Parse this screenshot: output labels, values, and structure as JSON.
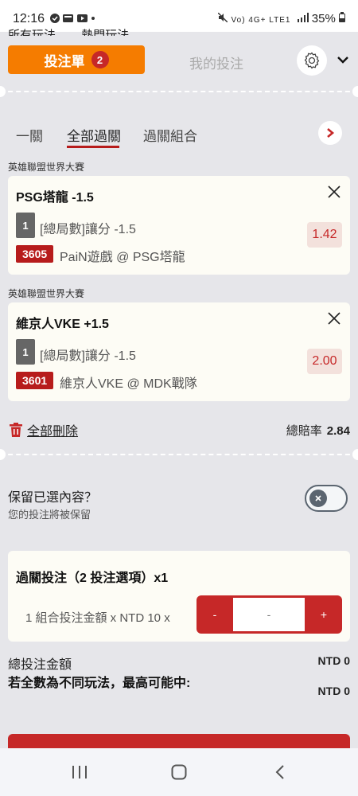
{
  "status": {
    "time": "12:16",
    "network": "Vo) 4G+ LTE1",
    "battery": "35%"
  },
  "behind_tabs": [
    "所有玩法",
    "熱門玩法"
  ],
  "header": {
    "betslip_label": "投注單",
    "betslip_count": "2",
    "mybets_label": "我的投注",
    "settings_icon": "gear-icon",
    "collapse_icon": "chevron-down-icon"
  },
  "parlay_tabs": [
    {
      "label": "一關",
      "active": false
    },
    {
      "label": "全部過關",
      "active": true
    },
    {
      "label": "過關組合",
      "active": false
    }
  ],
  "selections": [
    {
      "league": "英雄聯盟世界大賽",
      "title": "PSG塔龍 -1.5",
      "num": "1",
      "market": "[總局數]讓分 -1.5",
      "code": "3605",
      "match": "PaiN遊戲 @ PSG塔龍",
      "odds": "1.42"
    },
    {
      "league": "英雄聯盟世界大賽",
      "title": "維京人VKE +1.5",
      "num": "1",
      "market": "[總局數]讓分 -1.5",
      "code": "3601",
      "match": "維京人VKE @ MDK戰隊",
      "odds": "2.00"
    }
  ],
  "actions": {
    "delete_all": "全部刪除",
    "total_odds_label": "總賠率",
    "total_odds_value": "2.84"
  },
  "keep": {
    "title": "保留已選內容？",
    "subtitle": "您的投注將被保留",
    "enabled": false
  },
  "parlay": {
    "title": "過關投注（2 投注選項）x1",
    "stake_label": "1 組合投注金額 x NTD 10 x",
    "minus": "-",
    "amount_placeholder": "-",
    "plus": "+"
  },
  "summary": {
    "total_label": "總投注金額",
    "total_value": "NTD 0",
    "max_label": "若全數為不同玩法，最高可能中:",
    "max_value": "NTD 0"
  },
  "colors": {
    "accent_orange": "#f57c00",
    "accent_red": "#c62828"
  }
}
